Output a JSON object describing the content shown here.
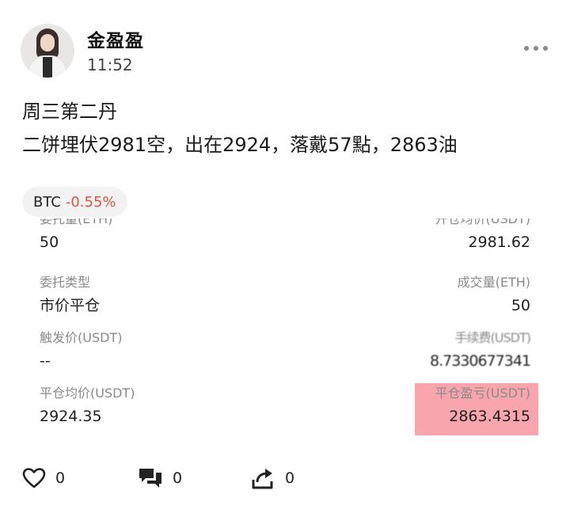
{
  "post": {
    "author": "金盈盈",
    "time": "11:52",
    "line1": "周三第二丹",
    "line2": "二饼埋伏2981空，出在2924，落戴57點，2863油"
  },
  "tag": {
    "symbol": "BTC",
    "change": "-0.55%"
  },
  "trade": {
    "order_qty_label": "委托量(ETH)",
    "order_qty_value": "50",
    "open_avg_label": "开仓均价(USDT)",
    "open_avg_value": "2981.62",
    "order_type_label": "委托类型",
    "order_type_value": "市价平仓",
    "filled_qty_label": "成交量(ETH)",
    "filled_qty_value": "50",
    "trigger_price_label": "触发价(USDT)",
    "trigger_price_value": "--",
    "fee_label": "手续费(USDT)",
    "fee_value": "8.7330677341",
    "close_avg_label": "平仓均价(USDT)",
    "close_avg_value": "2924.35",
    "pnl_label": "平仓盈亏(USDT)",
    "pnl_value": "2863.4315",
    "highlight_color": "#f68c96"
  },
  "actions": {
    "likes": "0",
    "comments": "0",
    "shares": "0"
  }
}
